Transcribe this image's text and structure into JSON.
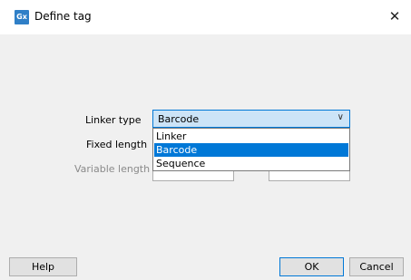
{
  "window": {
    "app_icon_text": "Gx",
    "title": "Define tag",
    "close_glyph": "✕"
  },
  "form": {
    "linker_type_label": "Linker type",
    "fixed_length_label": "Fixed length",
    "variable_length_label": "Variable length",
    "linker_type_value": "Barcode",
    "dropdown_arrow": "∨",
    "options": [
      "Linker",
      "Barcode",
      "Sequence"
    ],
    "selected_option": "Barcode"
  },
  "buttons": {
    "help": "Help",
    "ok": "OK",
    "cancel": "Cancel"
  },
  "colors": {
    "selection": "#0078d7",
    "select_bg": "#cce4f7",
    "dialog_bg": "#f0f0f0"
  }
}
